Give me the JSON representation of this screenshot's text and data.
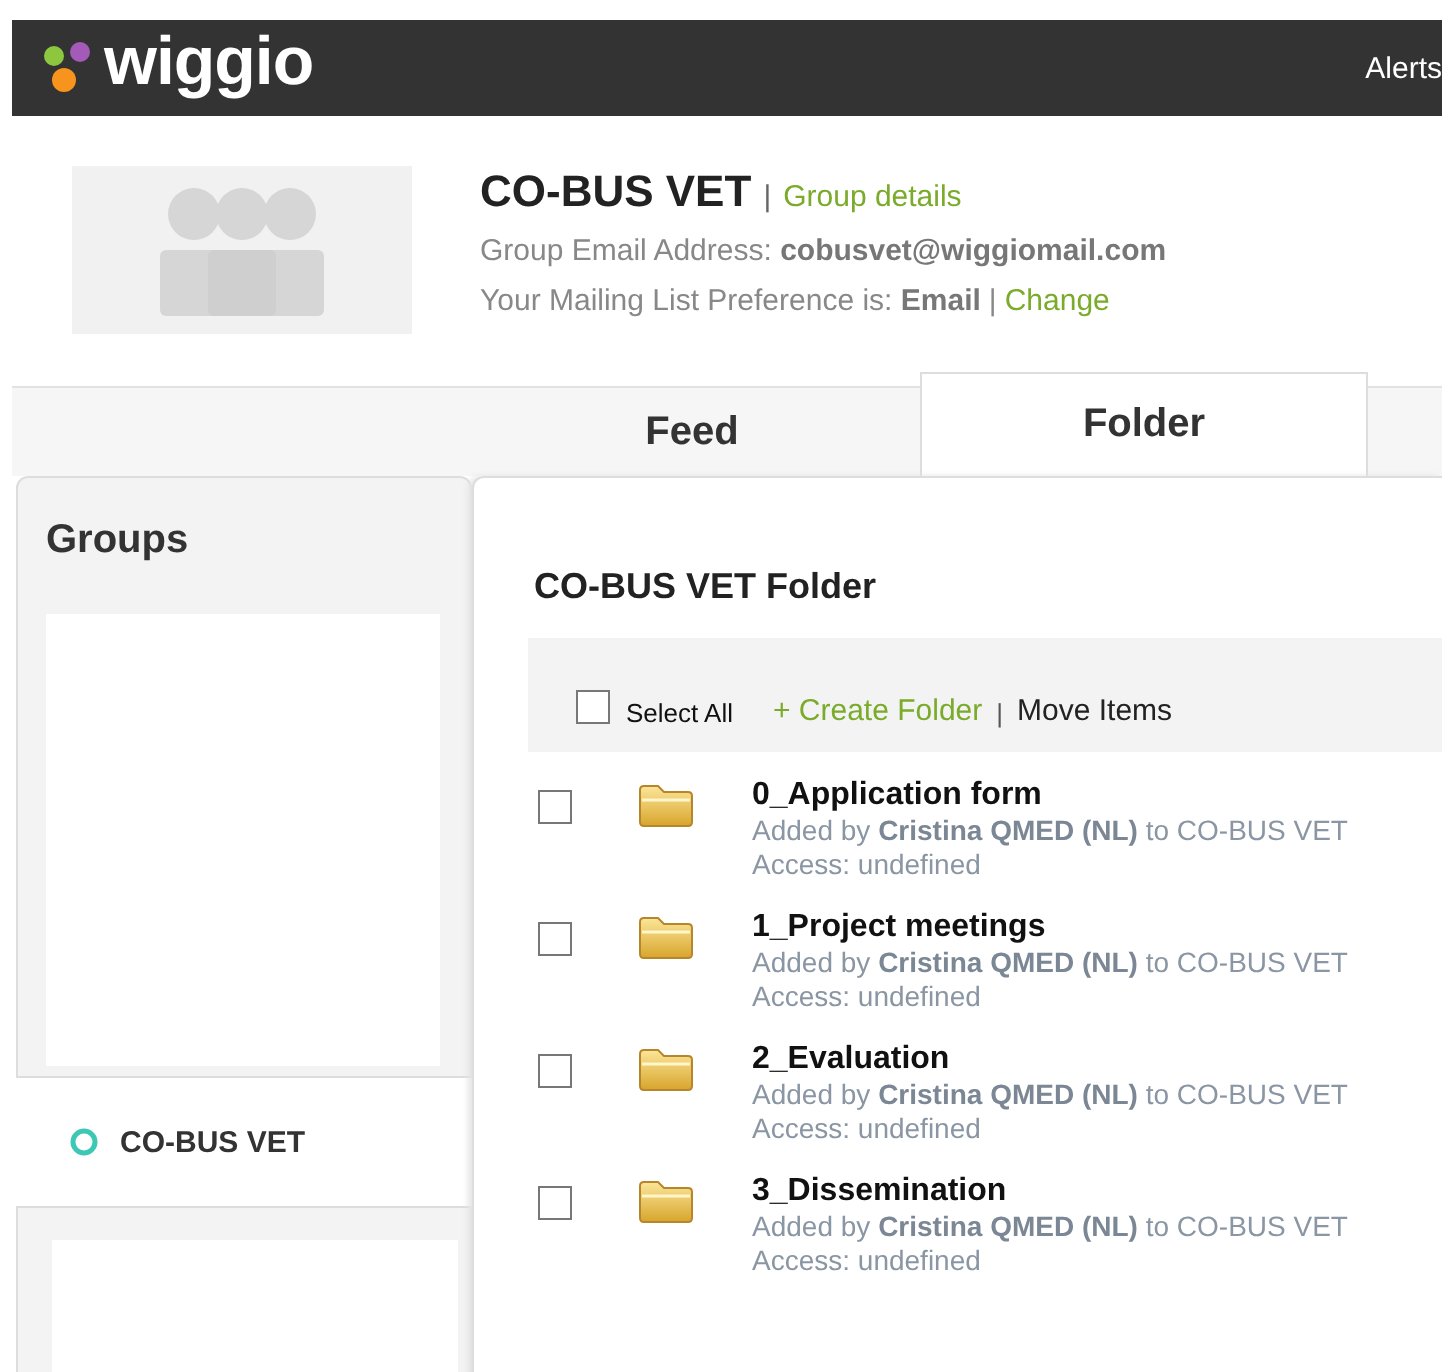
{
  "top_bar": {
    "logo": "wiggio",
    "alerts": "Alerts"
  },
  "group": {
    "name": "CO-BUS VET",
    "details_link": "Group details",
    "separator": "|",
    "email": "Group Email Address: **cobusvet@wiggiomail.com**",
    "preference": "Your Mailing List Preference is: **Email**",
    "preference_separator": "|",
    "change_link": "Change"
  },
  "tabs": [
    {
      "label": "Feed",
      "selected": false
    },
    {
      "label": "Folder",
      "selected": true
    }
  ],
  "sidebar": {
    "title": "Groups",
    "groups": [
      {
        "name": "CO-BUS VET"
      }
    ]
  },
  "folder": {
    "title": "CO-BUS VET Folder",
    "toolbar": {
      "select_all": {
        "label": "Select All",
        "checked": false
      },
      "create": "+ Create Folder",
      "separator": "|",
      "move": "Move Items"
    },
    "items": [
      {
        "name": "0_Application form",
        "added": "Added by **Cristina QMED (NL)** to CO-BUS VET",
        "access": "Access: undefined",
        "checked": false
      },
      {
        "name": "1_Project meetings",
        "added": "Added by **Cristina QMED (NL)** to CO-BUS VET",
        "access": "Access: undefined",
        "checked": false
      },
      {
        "name": "2_Evaluation",
        "added": "Added by **Cristina QMED (NL)** to CO-BUS VET",
        "access": "Access: undefined",
        "checked": false
      },
      {
        "name": "3_Dissemination",
        "added": "Added by **Cristina QMED (NL)** to CO-BUS VET",
        "access": "Access: undefined",
        "checked": false
      }
    ]
  }
}
